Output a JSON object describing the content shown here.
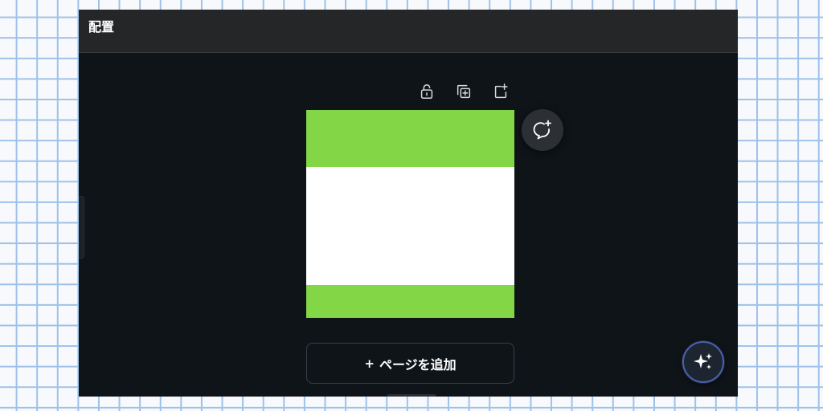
{
  "header": {
    "title": "配置"
  },
  "toolbar": {
    "lock_icon": "unlock-icon",
    "duplicate_icon": "duplicate-page-icon",
    "add_page_icon": "add-page-icon"
  },
  "page": {
    "band_color": "#83d646",
    "background_color": "#ffffff"
  },
  "comment": {
    "icon": "add-comment-icon"
  },
  "add_page_button": {
    "plus": "+",
    "label": "ページを追加"
  },
  "assistant": {
    "icon": "sparkle-icon"
  },
  "colors": {
    "app_background": "#0f1419",
    "header_background": "#252628",
    "accent_green": "#83d646"
  }
}
